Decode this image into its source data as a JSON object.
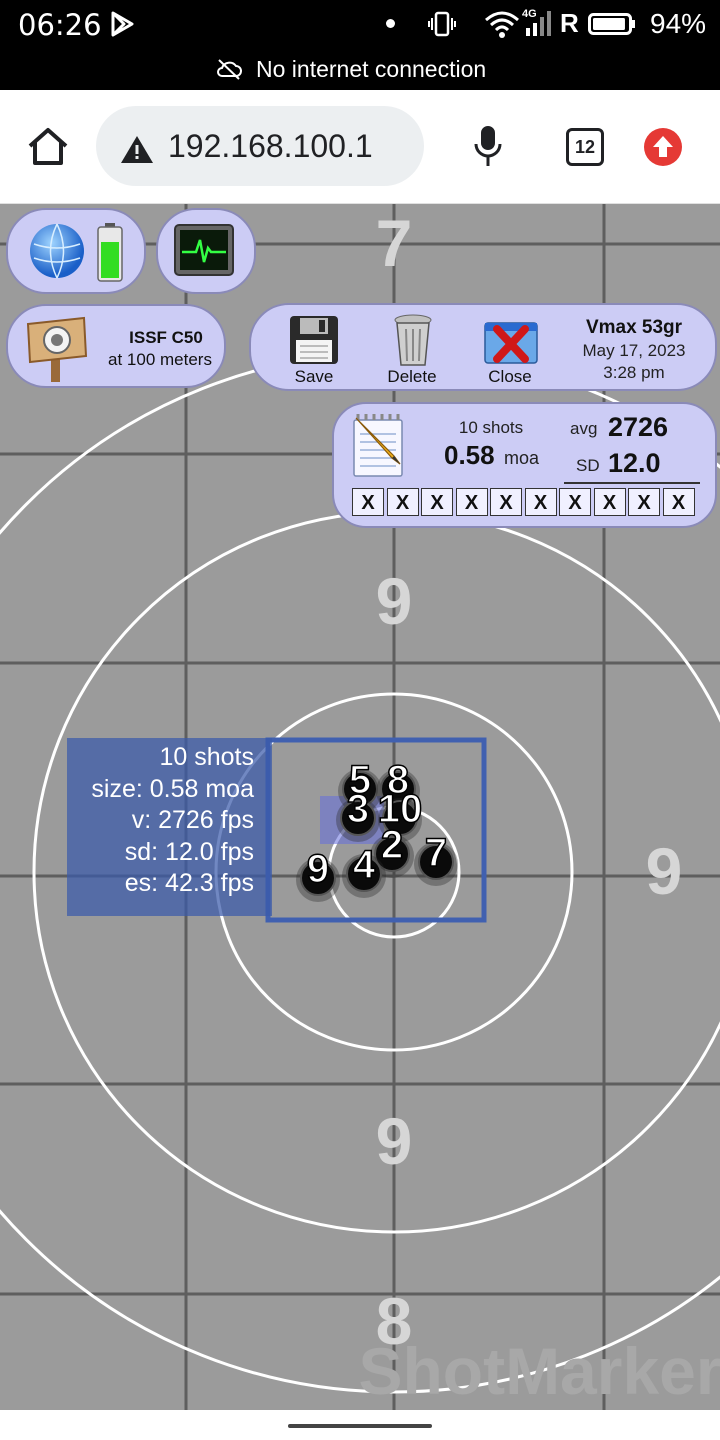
{
  "status_bar": {
    "time": "06:26",
    "carrier_tag": "4G",
    "roaming": "R",
    "battery_percent": "94%",
    "battery_level": 0.94,
    "network_notice": "No internet connection"
  },
  "browser": {
    "url": "192.168.100.1",
    "tab_count": "12"
  },
  "target_panel": {
    "name": "ISSF C50",
    "distance": "at 100 meters"
  },
  "actions": {
    "save": "Save",
    "delete": "Delete",
    "close": "Close"
  },
  "ammo": {
    "load": "Vmax 53gr",
    "date": "May 17, 2023",
    "time": "3:28 pm"
  },
  "stats": {
    "shots": "10 shots",
    "group_moa": "0.58",
    "moa_unit": "moa",
    "avg_label": "avg",
    "avg_value": "2726",
    "sd_label": "SD",
    "sd_value": "12.0",
    "marks": [
      "X",
      "X",
      "X",
      "X",
      "X",
      "X",
      "X",
      "X",
      "X",
      "X"
    ]
  },
  "group_info": {
    "shots": "10 shots",
    "size": "size: 0.58 moa",
    "velocity": "v: 2726 fps",
    "sd": "sd: 12.0 fps",
    "es": "es: 42.3 fps"
  },
  "target": {
    "ring_labels": [
      "7",
      "9",
      "9",
      "9",
      "8"
    ],
    "watermark": "ShotMarker",
    "shot_labels": [
      "5",
      "8",
      "3",
      "10",
      "2",
      "4",
      "9",
      "7"
    ]
  },
  "colors": {
    "panel_fill": "#ccccf5",
    "info_box": "#3a5aaa",
    "target_bg": "#9b9b9b",
    "status_bar": "#000000"
  }
}
